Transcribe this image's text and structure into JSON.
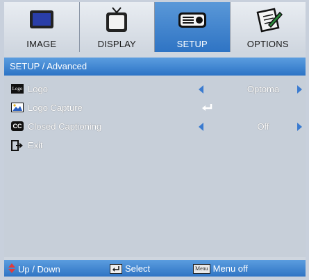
{
  "tabs": [
    {
      "label": "IMAGE",
      "icon": "monitor-icon",
      "active": false
    },
    {
      "label": "DISPLAY",
      "icon": "tv-icon",
      "active": false
    },
    {
      "label": "SETUP",
      "icon": "projector-icon",
      "active": true
    },
    {
      "label": "OPTIONS",
      "icon": "notepad-pencil-icon",
      "active": false
    }
  ],
  "header": {
    "title": "SETUP / Advanced"
  },
  "items": [
    {
      "label": "Logo",
      "icon": "logo-icon",
      "icon_text": "Logo",
      "value": "Optoma"
    },
    {
      "label": "Logo Capture",
      "icon": "image-capture-icon",
      "value": ""
    },
    {
      "label": "Closed Captioning",
      "icon": "cc-icon",
      "icon_text": "CC",
      "value": "Off"
    },
    {
      "label": "Exit",
      "icon": "exit-icon",
      "value": ""
    }
  ],
  "footer": {
    "updown_label": "Up / Down",
    "select_label": "Select",
    "menu_key": "Menu",
    "menu_label": "Menu off"
  },
  "colors": {
    "accent": "#2f74c4",
    "panel": "#c7cfd9"
  }
}
